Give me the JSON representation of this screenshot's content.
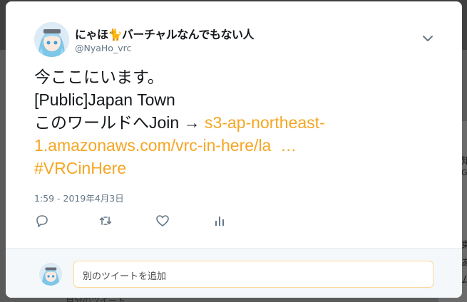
{
  "background": {
    "right_fragments": [
      "知",
      "G",
      "東",
      "あ",
      "ム"
    ],
    "bottom_text": "自分のツイート"
  },
  "tweet": {
    "display_name": "にゃほ🐈バーチャルなんでもない人",
    "handle": "@NyaHo_vrc",
    "lines": {
      "line1": "今ここにいます。",
      "line2": "[Public]Japan Town",
      "line3_text": "このワールドへJoin → ",
      "line3_link": "s3-ap-northeast-",
      "line4_link": "1.amazonaws.com/vrc-in-here/la  …",
      "line5_hashtag": "#VRCinHere"
    },
    "timestamp": "1:59 - 2019年4月3日",
    "link_color": "#f5a623"
  },
  "actions": {
    "reply_icon": "reply-icon",
    "retweet_icon": "retweet-icon",
    "like_icon": "heart-icon",
    "analytics_icon": "analytics-icon"
  },
  "reply": {
    "placeholder": "別のツイートを追加"
  }
}
